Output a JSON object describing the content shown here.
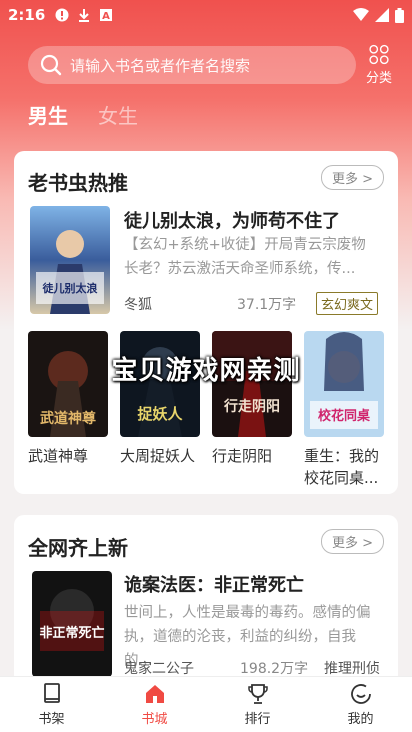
{
  "status_bar": {
    "time": "2:16"
  },
  "search": {
    "placeholder": "请输入书名或者作者名搜索"
  },
  "category": {
    "label": "分类"
  },
  "gender_tabs": [
    {
      "label": "男生",
      "active": true
    },
    {
      "label": "女生",
      "active": false
    }
  ],
  "section1": {
    "title": "老书虫热推",
    "more": "更多 >",
    "featured": {
      "title": "徒儿别太浪，为师苟不住了",
      "desc": "【玄幻+系统+收徒】开局青云宗废物长老？苏云激活天命圣师系统，传...",
      "author": "冬狐",
      "words": "37.1万字",
      "tag": "玄幻爽文",
      "cover_text": "徒儿别太浪为师苟不住"
    },
    "books": [
      {
        "name": "武道神尊",
        "cover_text": "武道神尊"
      },
      {
        "name": "大周捉妖人",
        "cover_text": "捉妖人"
      },
      {
        "name": "行走阴阳",
        "cover_text": "行走阴阳"
      },
      {
        "name": "重生：我的校花同桌...",
        "cover_text": "校花同桌"
      }
    ]
  },
  "watermark": "宝贝游戏网亲测",
  "section2": {
    "title": "全网齐上新",
    "more": "更多 >",
    "featured": {
      "title": "诡案法医：非正常死亡",
      "desc": "世间上，人性是最毒的毒药。感情的偏执，道德的沦丧，利益的纠纷，自我的...",
      "author": "鬼家二公子",
      "words": "198.2万字",
      "tag": "推理刑侦",
      "cover_text": "非正常死亡"
    }
  },
  "bottom_nav": [
    {
      "label": "书架",
      "icon": "bookshelf-icon",
      "active": false
    },
    {
      "label": "书城",
      "icon": "bookstore-icon",
      "active": true
    },
    {
      "label": "排行",
      "icon": "ranking-icon",
      "active": false
    },
    {
      "label": "我的",
      "icon": "profile-icon",
      "active": false
    }
  ],
  "colors": {
    "accent": "#f04a43",
    "tag_border": "#8a7a2a"
  }
}
